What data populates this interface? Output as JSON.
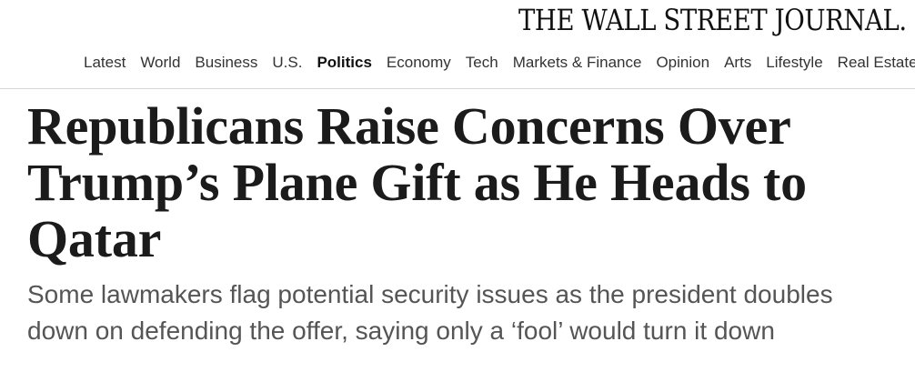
{
  "masthead": {
    "title": "THE WALL STREET JOURNAL."
  },
  "nav": {
    "items": [
      {
        "label": "Latest"
      },
      {
        "label": "World"
      },
      {
        "label": "Business"
      },
      {
        "label": "U.S."
      },
      {
        "label": "Politics",
        "active": true
      },
      {
        "label": "Economy"
      },
      {
        "label": "Tech"
      },
      {
        "label": "Markets & Finance"
      },
      {
        "label": "Opinion"
      },
      {
        "label": "Arts"
      },
      {
        "label": "Lifestyle"
      },
      {
        "label": "Real Estate"
      }
    ]
  },
  "article": {
    "headline": "Republicans Raise Concerns Over Trump’s Plane Gift as He Heads to Qatar",
    "dek": "Some lawmakers flag potential security issues as the president doubles down on defending the offer, saying only a ‘fool’ would turn it down"
  }
}
